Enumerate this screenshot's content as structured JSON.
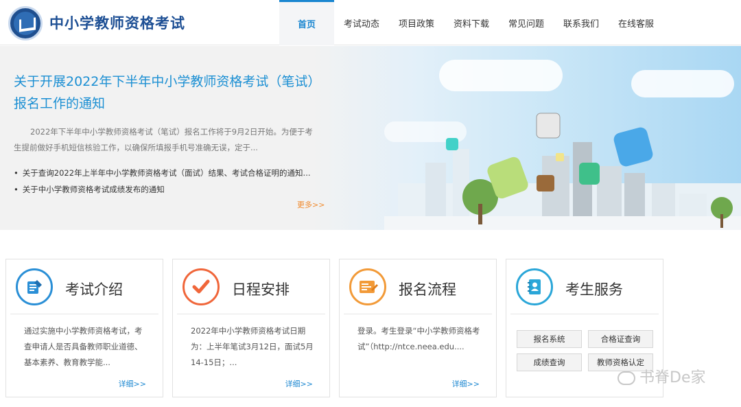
{
  "header": {
    "site_title": "中小学教师资格考试",
    "nav": [
      "首页",
      "考试动态",
      "项目政策",
      "资料下载",
      "常见问题",
      "联系我们",
      "在线客服"
    ]
  },
  "banner": {
    "headline": "关于开展2022年下半年中小学教师资格考试（笔试）报名工作的通知",
    "summary": "2022年下半年中小学教师资格考试（笔试）报名工作将于9月2日开始。为便于考生提前做好手机短信核验工作，以确保所填报手机号准确无误，定于...",
    "news": [
      "关于查询2022年上半年中小学教师资格考试（面试）结果、考试合格证明的通知...",
      "关于中小学教师资格考试成绩发布的通知"
    ],
    "more": "更多>>"
  },
  "cards": [
    {
      "title": "考试介绍",
      "text": "通过实施中小学教师资格考试，考查申请人是否具备教师职业道德、基本素养、教育教学能...",
      "more": "详细>>",
      "icon": "document-edit-icon",
      "color": "#2a8fd6"
    },
    {
      "title": "日程安排",
      "text": "2022年中小学教师资格考试日期为：上半年笔试3月12日，面试5月14-15日；...",
      "more": "详细>>",
      "icon": "checkmark-icon",
      "color": "#f0663a"
    },
    {
      "title": "报名流程",
      "text": "登录。考生登录“中小学教师资格考试”（http://ntce.neea.edu....",
      "more": "详细>>",
      "icon": "registration-form-icon",
      "color": "#f29a38"
    },
    {
      "title": "考生服务",
      "icon": "address-book-icon",
      "color": "#2aa6d8"
    }
  ],
  "services": [
    "报名系统",
    "合格证查询",
    "成绩查询",
    "教师资格认定"
  ],
  "watermark": "书脊De家"
}
